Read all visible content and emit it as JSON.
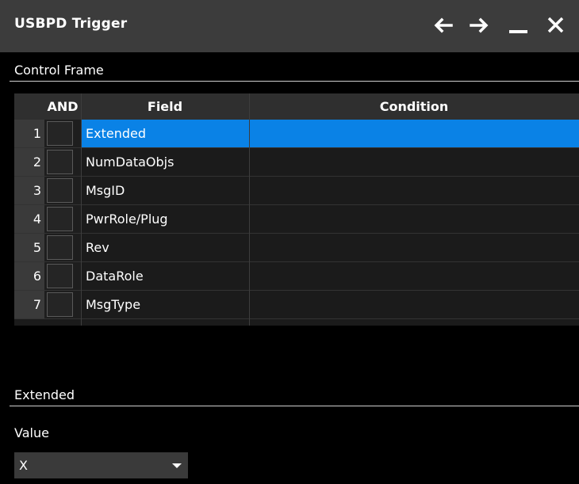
{
  "window": {
    "title": "USBPD Trigger"
  },
  "control_frame": {
    "label": "Control Frame",
    "columns": {
      "and": "AND",
      "field": "Field",
      "condition": "Condition"
    },
    "rows": [
      {
        "num": "1",
        "field": "Extended",
        "condition": "",
        "selected": true
      },
      {
        "num": "2",
        "field": "NumDataObjs",
        "condition": ""
      },
      {
        "num": "3",
        "field": "MsgID",
        "condition": ""
      },
      {
        "num": "4",
        "field": "PwrRole/Plug",
        "condition": ""
      },
      {
        "num": "5",
        "field": "Rev",
        "condition": ""
      },
      {
        "num": "6",
        "field": "DataRole",
        "condition": ""
      },
      {
        "num": "7",
        "field": "MsgType",
        "condition": ""
      }
    ]
  },
  "extended": {
    "label": "Extended",
    "value_label": "Value",
    "value": "X"
  },
  "colors": {
    "selection": "#0a82e6",
    "titlebar": "#3c3c3c"
  },
  "icons": [
    "back-arrow-icon",
    "forward-arrow-icon",
    "minimize-icon",
    "close-icon"
  ]
}
